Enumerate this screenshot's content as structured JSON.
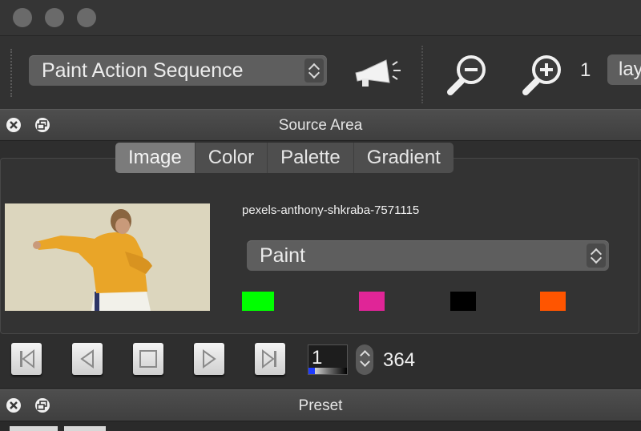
{
  "window": {
    "traffic_lights": [
      "close",
      "minimize",
      "zoom"
    ]
  },
  "toolbar": {
    "action_select": {
      "value": "Paint Action Sequence"
    },
    "icons": [
      "megaphone-icon",
      "zoom-out-icon",
      "zoom-in-icon"
    ],
    "zoom_level": "1",
    "layer_select": {
      "value": "lay"
    }
  },
  "source_area": {
    "title": "Source Area",
    "tabs": [
      {
        "label": "Image",
        "active": true
      },
      {
        "label": "Color",
        "active": false
      },
      {
        "label": "Palette",
        "active": false
      },
      {
        "label": "Gradient",
        "active": false
      }
    ],
    "filename": "pexels-anthony-shkraba-7571115",
    "mode_select": {
      "value": "Paint"
    },
    "swatches": [
      "#00ff00",
      "#e02597",
      "#000000",
      "#ff5500"
    ],
    "playback": {
      "frame": "1",
      "total": "364",
      "buttons": [
        "first-frame",
        "previous-frame",
        "stop",
        "play",
        "last-frame"
      ]
    }
  },
  "preset": {
    "title": "Preset"
  }
}
